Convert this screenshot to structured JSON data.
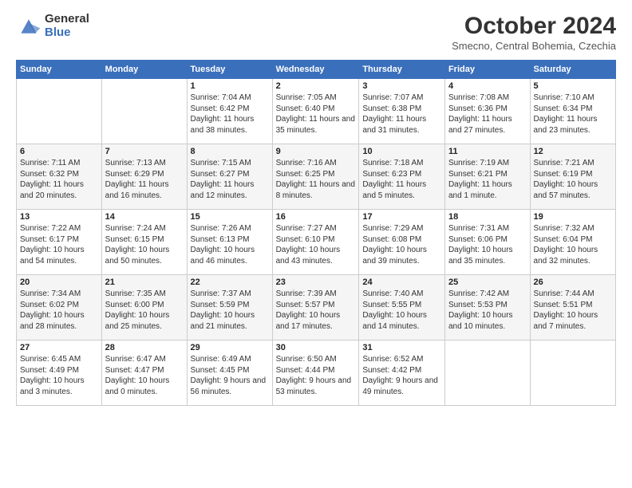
{
  "header": {
    "logo_general": "General",
    "logo_blue": "Blue",
    "month_title": "October 2024",
    "location": "Smecno, Central Bohemia, Czechia"
  },
  "days_of_week": [
    "Sunday",
    "Monday",
    "Tuesday",
    "Wednesday",
    "Thursday",
    "Friday",
    "Saturday"
  ],
  "weeks": [
    [
      {
        "day": "",
        "info": ""
      },
      {
        "day": "",
        "info": ""
      },
      {
        "day": "1",
        "info": "Sunrise: 7:04 AM\nSunset: 6:42 PM\nDaylight: 11 hours and 38 minutes."
      },
      {
        "day": "2",
        "info": "Sunrise: 7:05 AM\nSunset: 6:40 PM\nDaylight: 11 hours and 35 minutes."
      },
      {
        "day": "3",
        "info": "Sunrise: 7:07 AM\nSunset: 6:38 PM\nDaylight: 11 hours and 31 minutes."
      },
      {
        "day": "4",
        "info": "Sunrise: 7:08 AM\nSunset: 6:36 PM\nDaylight: 11 hours and 27 minutes."
      },
      {
        "day": "5",
        "info": "Sunrise: 7:10 AM\nSunset: 6:34 PM\nDaylight: 11 hours and 23 minutes."
      }
    ],
    [
      {
        "day": "6",
        "info": "Sunrise: 7:11 AM\nSunset: 6:32 PM\nDaylight: 11 hours and 20 minutes."
      },
      {
        "day": "7",
        "info": "Sunrise: 7:13 AM\nSunset: 6:29 PM\nDaylight: 11 hours and 16 minutes."
      },
      {
        "day": "8",
        "info": "Sunrise: 7:15 AM\nSunset: 6:27 PM\nDaylight: 11 hours and 12 minutes."
      },
      {
        "day": "9",
        "info": "Sunrise: 7:16 AM\nSunset: 6:25 PM\nDaylight: 11 hours and 8 minutes."
      },
      {
        "day": "10",
        "info": "Sunrise: 7:18 AM\nSunset: 6:23 PM\nDaylight: 11 hours and 5 minutes."
      },
      {
        "day": "11",
        "info": "Sunrise: 7:19 AM\nSunset: 6:21 PM\nDaylight: 11 hours and 1 minute."
      },
      {
        "day": "12",
        "info": "Sunrise: 7:21 AM\nSunset: 6:19 PM\nDaylight: 10 hours and 57 minutes."
      }
    ],
    [
      {
        "day": "13",
        "info": "Sunrise: 7:22 AM\nSunset: 6:17 PM\nDaylight: 10 hours and 54 minutes."
      },
      {
        "day": "14",
        "info": "Sunrise: 7:24 AM\nSunset: 6:15 PM\nDaylight: 10 hours and 50 minutes."
      },
      {
        "day": "15",
        "info": "Sunrise: 7:26 AM\nSunset: 6:13 PM\nDaylight: 10 hours and 46 minutes."
      },
      {
        "day": "16",
        "info": "Sunrise: 7:27 AM\nSunset: 6:10 PM\nDaylight: 10 hours and 43 minutes."
      },
      {
        "day": "17",
        "info": "Sunrise: 7:29 AM\nSunset: 6:08 PM\nDaylight: 10 hours and 39 minutes."
      },
      {
        "day": "18",
        "info": "Sunrise: 7:31 AM\nSunset: 6:06 PM\nDaylight: 10 hours and 35 minutes."
      },
      {
        "day": "19",
        "info": "Sunrise: 7:32 AM\nSunset: 6:04 PM\nDaylight: 10 hours and 32 minutes."
      }
    ],
    [
      {
        "day": "20",
        "info": "Sunrise: 7:34 AM\nSunset: 6:02 PM\nDaylight: 10 hours and 28 minutes."
      },
      {
        "day": "21",
        "info": "Sunrise: 7:35 AM\nSunset: 6:00 PM\nDaylight: 10 hours and 25 minutes."
      },
      {
        "day": "22",
        "info": "Sunrise: 7:37 AM\nSunset: 5:59 PM\nDaylight: 10 hours and 21 minutes."
      },
      {
        "day": "23",
        "info": "Sunrise: 7:39 AM\nSunset: 5:57 PM\nDaylight: 10 hours and 17 minutes."
      },
      {
        "day": "24",
        "info": "Sunrise: 7:40 AM\nSunset: 5:55 PM\nDaylight: 10 hours and 14 minutes."
      },
      {
        "day": "25",
        "info": "Sunrise: 7:42 AM\nSunset: 5:53 PM\nDaylight: 10 hours and 10 minutes."
      },
      {
        "day": "26",
        "info": "Sunrise: 7:44 AM\nSunset: 5:51 PM\nDaylight: 10 hours and 7 minutes."
      }
    ],
    [
      {
        "day": "27",
        "info": "Sunrise: 6:45 AM\nSunset: 4:49 PM\nDaylight: 10 hours and 3 minutes."
      },
      {
        "day": "28",
        "info": "Sunrise: 6:47 AM\nSunset: 4:47 PM\nDaylight: 10 hours and 0 minutes."
      },
      {
        "day": "29",
        "info": "Sunrise: 6:49 AM\nSunset: 4:45 PM\nDaylight: 9 hours and 56 minutes."
      },
      {
        "day": "30",
        "info": "Sunrise: 6:50 AM\nSunset: 4:44 PM\nDaylight: 9 hours and 53 minutes."
      },
      {
        "day": "31",
        "info": "Sunrise: 6:52 AM\nSunset: 4:42 PM\nDaylight: 9 hours and 49 minutes."
      },
      {
        "day": "",
        "info": ""
      },
      {
        "day": "",
        "info": ""
      }
    ]
  ]
}
